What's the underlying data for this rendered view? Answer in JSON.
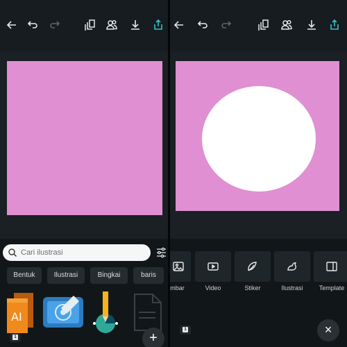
{
  "left_panel": {
    "toolbar": {
      "icons": [
        "back-arrow-icon",
        "undo-icon",
        "redo-icon",
        "layers-icon",
        "collaborate-icon",
        "download-icon",
        "share-icon"
      ]
    },
    "search": {
      "placeholder": "Cari ilustrasi"
    },
    "chips": [
      "Bentuk",
      "Ilustrasi",
      "Bingkai",
      "baris"
    ],
    "thumbnails": [
      "ai-file-icon",
      "graphics-tablet-icon",
      "pencil-chart-icon",
      "document-icon"
    ],
    "page_badge": "1",
    "add_button": "+"
  },
  "right_panel": {
    "toolbar": {
      "icons": [
        "back-arrow-icon",
        "undo-icon",
        "redo-icon",
        "layers-icon",
        "collaborate-icon",
        "download-icon",
        "share-icon"
      ]
    },
    "tools": [
      {
        "label": "ambar",
        "icon": "image-icon"
      },
      {
        "label": "Video",
        "icon": "video-icon"
      },
      {
        "label": "Stiker",
        "icon": "sticker-icon"
      },
      {
        "label": "Ilustrasi",
        "icon": "illustration-icon"
      },
      {
        "label": "Template",
        "icon": "template-icon"
      }
    ],
    "page_badge": "1",
    "close_button": "×"
  },
  "colors": {
    "page_background": "#df8fd2",
    "accent": "#35c2c9",
    "panel": "#111719"
  }
}
